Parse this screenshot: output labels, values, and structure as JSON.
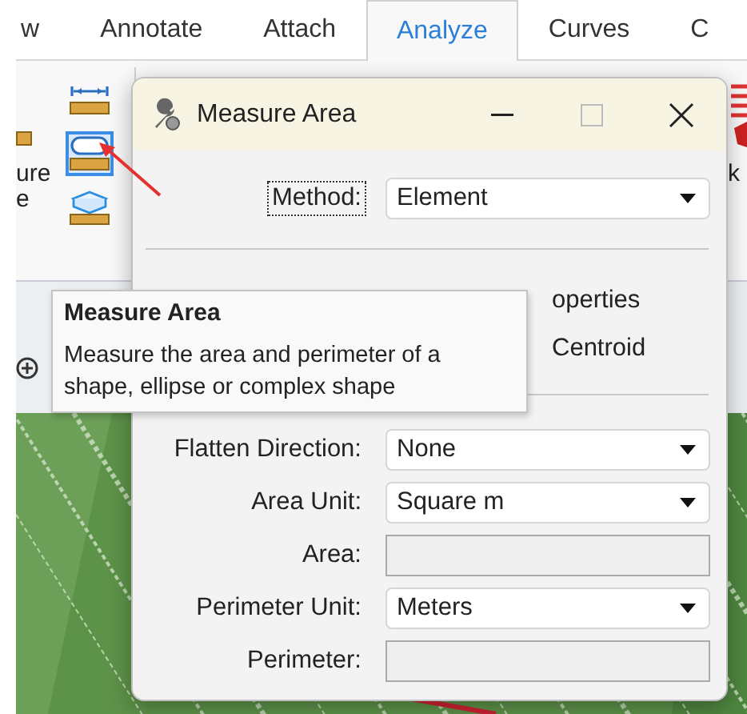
{
  "tabs": [
    {
      "label": "w",
      "selected": false
    },
    {
      "label": "Annotate",
      "selected": false
    },
    {
      "label": "Attach",
      "selected": false
    },
    {
      "label": "Analyze",
      "selected": true
    },
    {
      "label": "Curves",
      "selected": false
    },
    {
      "label": "C",
      "selected": false
    }
  ],
  "ribbon": {
    "left_label_lines": [
      "ure",
      "e"
    ],
    "right_label": "k",
    "tools": [
      {
        "kind": "distance",
        "selected": false
      },
      {
        "kind": "area",
        "selected": true
      },
      {
        "kind": "volume",
        "selected": false
      }
    ]
  },
  "dialog": {
    "title": "Measure Area",
    "method": {
      "label": "Method:",
      "value": "Element",
      "focused": true
    },
    "options": [
      {
        "label": "operties"
      },
      {
        "label": "Centroid"
      }
    ],
    "fields": [
      {
        "kind": "dropdown",
        "label": "Flatten Direction:",
        "value": "None"
      },
      {
        "kind": "dropdown",
        "label": "Area Unit:",
        "value": "Square m"
      },
      {
        "kind": "output",
        "label": "Area:"
      },
      {
        "kind": "dropdown",
        "label": "Perimeter Unit:",
        "value": "Meters"
      },
      {
        "kind": "output",
        "label": "Perimeter:"
      }
    ]
  },
  "tooltip": {
    "title": "Measure Area",
    "lines": [
      "Measure the area and perimeter of a",
      "shape, ellipse or complex shape"
    ]
  }
}
